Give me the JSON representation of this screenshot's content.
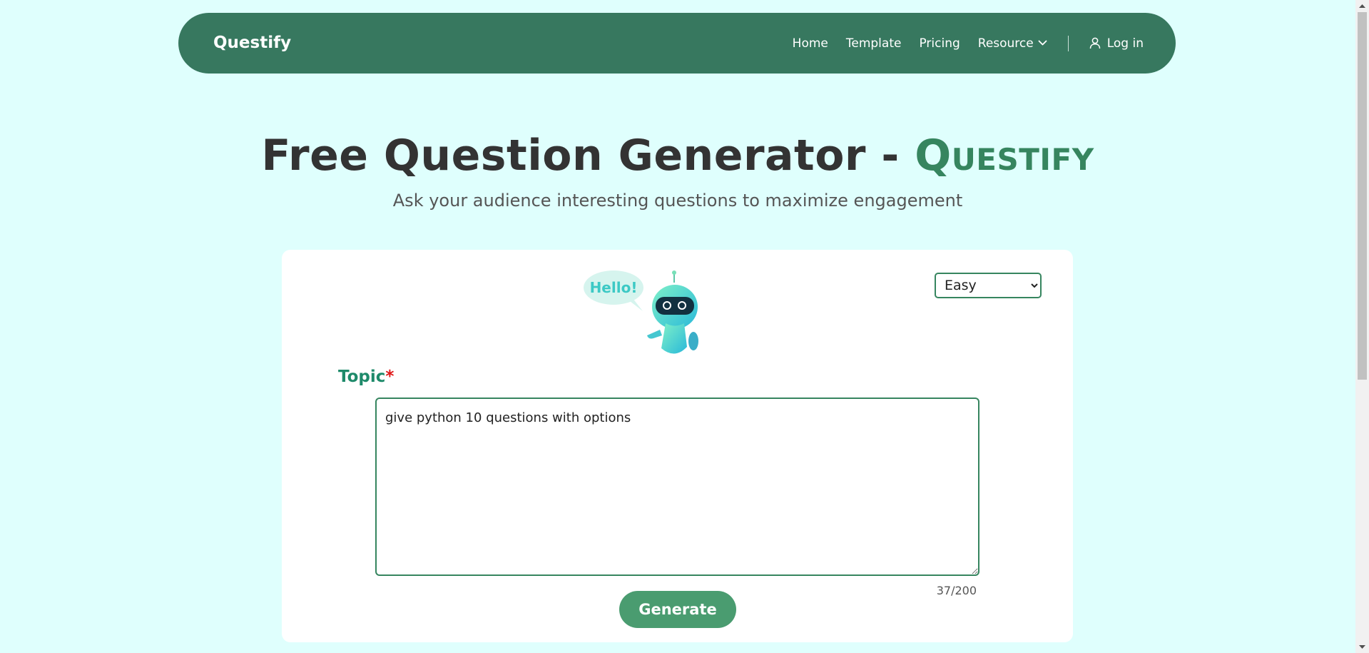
{
  "nav": {
    "brand": "Questify",
    "links": [
      "Home",
      "Template",
      "Pricing"
    ],
    "resource": "Resource",
    "login": "Log in"
  },
  "hero": {
    "title": "Free Question Generator - ",
    "brand": "Questify",
    "subtitle": "Ask your audience interesting questions to maximize engagement"
  },
  "form": {
    "robot_bubble": "Hello!",
    "difficulty": {
      "selected": "Easy",
      "options": [
        "Easy"
      ]
    },
    "topic_label": "Topic",
    "required_mark": "*",
    "topic_value": "give python 10 questions with options",
    "char_count": "37/200",
    "generate_label": "Generate"
  },
  "colors": {
    "nav_bg": "#37785f",
    "page_bg": "#dffffd",
    "accent": "#36855f",
    "button": "#4a9c70",
    "label": "#1e8a6a"
  },
  "icons": [
    "chevron-down-icon",
    "user-icon",
    "robot-mascot"
  ]
}
